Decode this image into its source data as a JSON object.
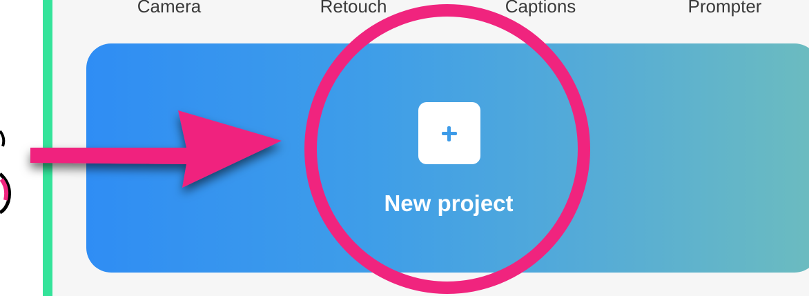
{
  "tools": [
    {
      "label": "Camera"
    },
    {
      "label": "Retouch"
    },
    {
      "label": "Captions"
    },
    {
      "label": "Prompter"
    }
  ],
  "card": {
    "label": "New project",
    "icon": "plus-icon"
  },
  "annotation": {
    "color": "#f0247e",
    "shapes": [
      "circle-highlight",
      "arrow"
    ]
  }
}
